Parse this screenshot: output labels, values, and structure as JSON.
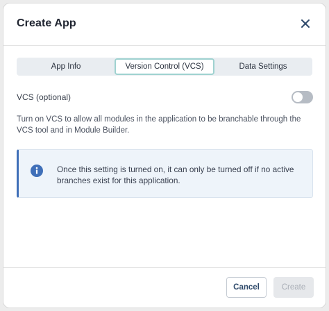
{
  "dialog": {
    "title": "Create App",
    "close_icon": "close-icon"
  },
  "tabs": [
    {
      "label": "App Info",
      "active": false
    },
    {
      "label": "Version Control (VCS)",
      "active": true
    },
    {
      "label": "Data Settings",
      "active": false
    }
  ],
  "vcs": {
    "label": "VCS (optional)",
    "toggle_on": false,
    "description": "Turn on VCS to allow all modules in the application to be branchable through the VCS tool and in Module Builder."
  },
  "info": {
    "icon": "info-icon",
    "text": "Once this setting is turned on, it can only be turned off if no active branches exist for this application."
  },
  "footer": {
    "cancel_label": "Cancel",
    "create_label": "Create",
    "create_disabled": true
  },
  "colors": {
    "accent_border": "#9fd2d0",
    "info_bar": "#3f6fb8",
    "info_bg": "#eef4fa",
    "toggle_off": "#b6bcc4"
  }
}
